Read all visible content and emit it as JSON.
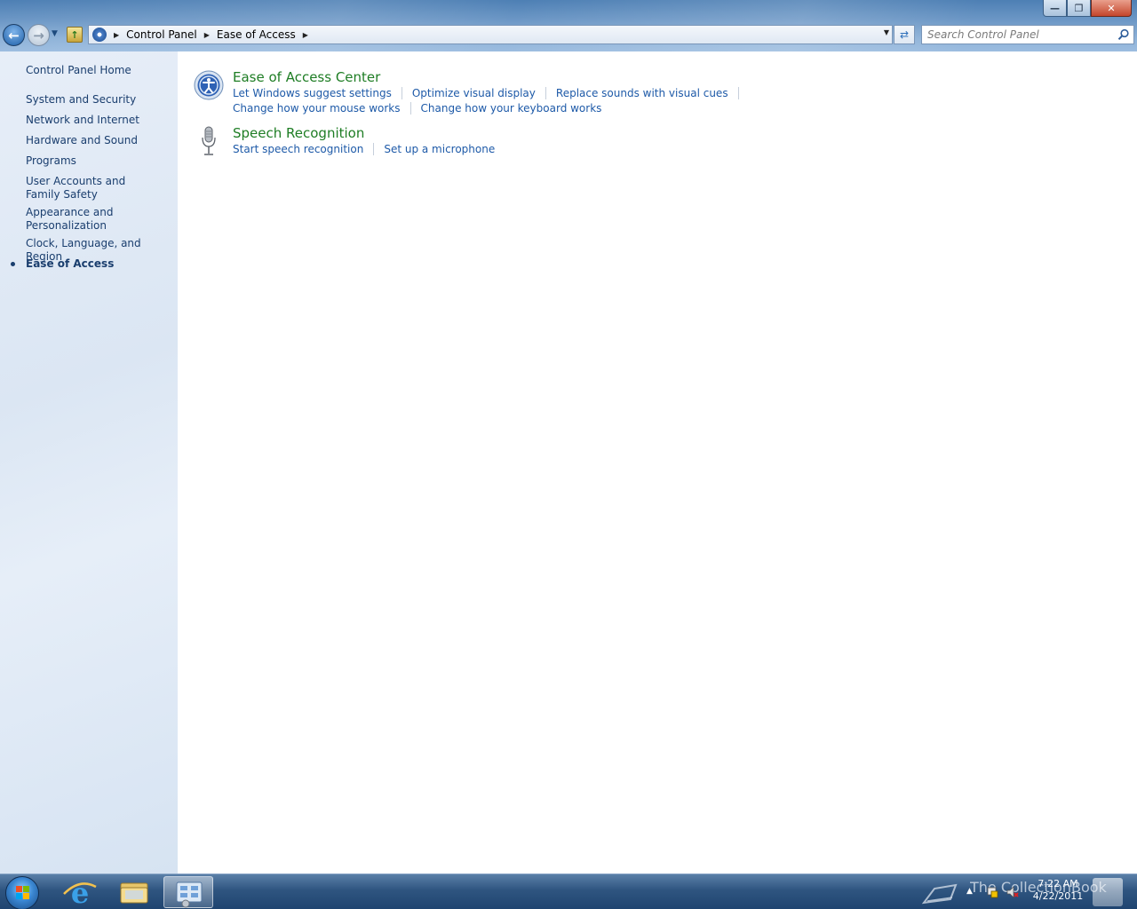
{
  "window": {
    "controls": {
      "minimize": "—",
      "maximize": "❐",
      "close": "✕"
    }
  },
  "navigation": {
    "back_icon": "back-arrow-icon",
    "forward_icon": "forward-arrow-icon",
    "refresh_icon": "refresh-icon"
  },
  "address_bar": {
    "breadcrumbs": [
      "Control Panel",
      "Ease of Access"
    ]
  },
  "search": {
    "placeholder": "Search Control Panel"
  },
  "sidebar": {
    "items": [
      {
        "label": "Control Panel Home"
      },
      {
        "label": "System and Security"
      },
      {
        "label": "Network and Internet"
      },
      {
        "label": "Hardware and Sound"
      },
      {
        "label": "Programs"
      },
      {
        "label": "User Accounts and Family Safety"
      },
      {
        "label": "Appearance and Personalization"
      },
      {
        "label": "Clock, Language, and Region"
      },
      {
        "label": "Ease of Access",
        "current": true
      }
    ]
  },
  "main": {
    "categories": [
      {
        "title": "Ease of Access Center",
        "icon": "ease-of-access-icon",
        "tasks_row1": [
          "Let Windows suggest settings",
          "Optimize visual display",
          "Replace sounds with visual cues"
        ],
        "tasks_row2": [
          "Change how your mouse works",
          "Change how your keyboard works"
        ]
      },
      {
        "title": "Speech Recognition",
        "icon": "microphone-icon",
        "tasks_row1": [
          "Start speech recognition",
          "Set up a microphone"
        ]
      }
    ]
  },
  "taskbar": {
    "clock_time": "7:22 AM",
    "clock_date": "4/22/2011",
    "watermark": "The CollectionBook",
    "colors": {
      "link": "#1e5aa8",
      "category_title": "#1e7d24",
      "nav_text": "#1a3e6e"
    }
  }
}
